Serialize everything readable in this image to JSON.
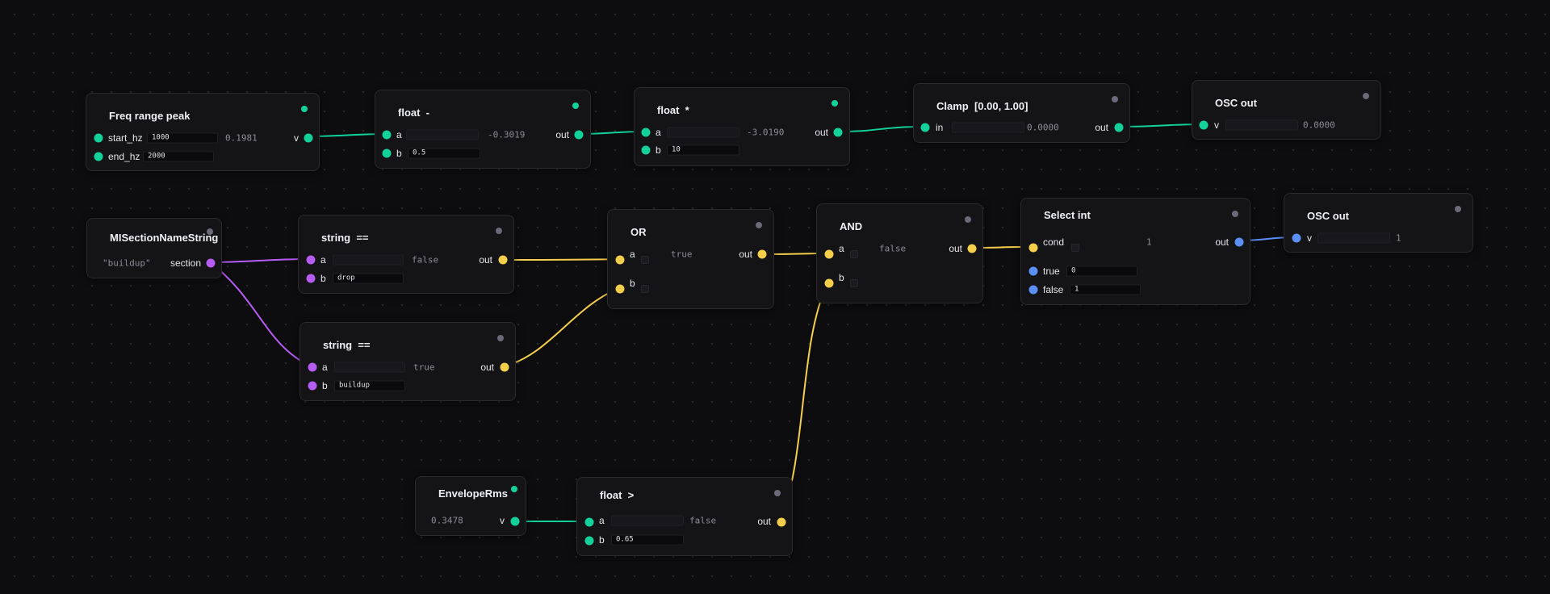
{
  "colors": {
    "float": "#12d19b",
    "bool": "#f5cf4c",
    "string": "#b65cf3",
    "int": "#5b8ff5"
  },
  "nodes": {
    "freq": {
      "title": "Freq range peak",
      "start_label": "start_hz",
      "start_value": "1000",
      "end_label": "end_hz",
      "end_value": "2000",
      "output": "0.1981",
      "out_label": "v"
    },
    "fminus": {
      "title": "float  -",
      "a_label": "a",
      "a_value": "",
      "output": "-0.3019",
      "out_label": "out",
      "b_label": "b",
      "b_value": "0.5"
    },
    "fmul": {
      "title": "float  *",
      "a_label": "a",
      "a_value": "",
      "output": "-3.0190",
      "out_label": "out",
      "b_label": "b",
      "b_value": "10"
    },
    "clamp": {
      "title": "Clamp  [0.00, 1.00]",
      "in_label": "in",
      "output": "0.0000",
      "out_label": "out"
    },
    "osc1": {
      "title": "OSC out",
      "v_label": "v",
      "value": "0.0000"
    },
    "misection": {
      "title": "MISectionNameString",
      "value": "\"buildup\"",
      "out_label": "section"
    },
    "streq1": {
      "title": "string  ==",
      "a_label": "a",
      "output": "false",
      "out_label": "out",
      "b_label": "b",
      "b_value": "drop"
    },
    "streq2": {
      "title": "string  ==",
      "a_label": "a",
      "output": "true",
      "out_label": "out",
      "b_label": "b",
      "b_value": "buildup"
    },
    "or": {
      "title": "OR",
      "a_label": "a",
      "output": "true",
      "out_label": "out",
      "b_label": "b"
    },
    "and": {
      "title": "AND",
      "a_label": "a",
      "output": "false",
      "out_label": "out",
      "b_label": "b"
    },
    "select": {
      "title": "Select int",
      "cond_label": "cond",
      "output": "1",
      "out_label": "out",
      "true_label": "true",
      "true_value": "0",
      "false_label": "false",
      "false_value": "1"
    },
    "osc2": {
      "title": "OSC out",
      "v_label": "v",
      "value": "1"
    },
    "env": {
      "title": "EnvelopeRms",
      "value": "0.3478",
      "out_label": "v"
    },
    "fgt": {
      "title": "float  >",
      "a_label": "a",
      "output": "false",
      "out_label": "out",
      "b_label": "b",
      "b_value": "0.65"
    }
  }
}
